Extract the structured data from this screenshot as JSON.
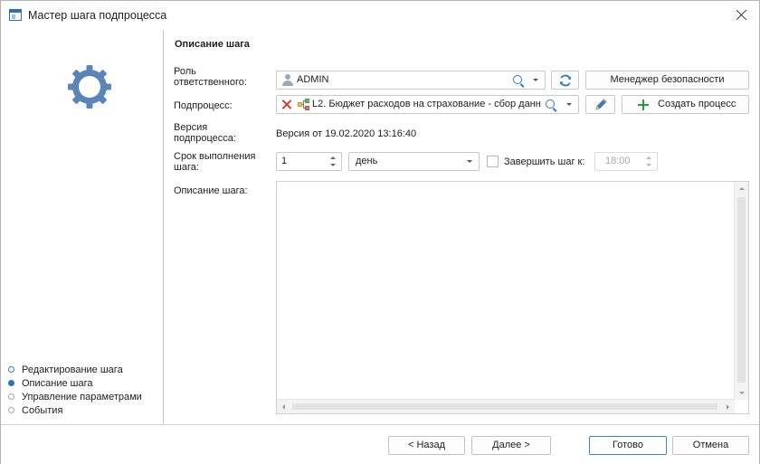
{
  "window": {
    "title": "Мастер шага подпроцесса"
  },
  "steps": [
    {
      "label": "Редактирование шага",
      "state": "done"
    },
    {
      "label": "Описание шага",
      "state": "active"
    },
    {
      "label": "Управление параметрами",
      "state": "pending"
    },
    {
      "label": "События",
      "state": "pending"
    }
  ],
  "section": {
    "heading": "Описание шага"
  },
  "fields": {
    "role": {
      "label_line1": "Роль",
      "label_line2": "ответственного:",
      "value": "ADMIN"
    },
    "security_manager_label": "Менеджер безопасности",
    "subprocess": {
      "label": "Подпроцесс:",
      "value": "L2. Бюджет расходов на страхование - сбор данн"
    },
    "create_process_label": "Создать процесс",
    "version": {
      "label_line1": "Версия",
      "label_line2": "подпроцесса:",
      "value": "Версия от 19.02.2020 13:16:40"
    },
    "deadline": {
      "label_line1": "Срок выполнения",
      "label_line2": "шага:",
      "value": "1",
      "unit": "день"
    },
    "finish_step": {
      "label": "Завершить шаг к:",
      "time": "18:00",
      "checked": false
    },
    "description": {
      "label": "Описание шага:",
      "value": ""
    }
  },
  "footer": {
    "back_label": "< Назад",
    "next_label": "Далее >",
    "done_label": "Готово",
    "cancel_label": "Отмена"
  },
  "colors": {
    "accent": "#2e73b8",
    "gear": "#5b85b8",
    "refresh": "#2a7bcb",
    "create_plus": "#2a9a3a",
    "error": "#d23a3a"
  }
}
